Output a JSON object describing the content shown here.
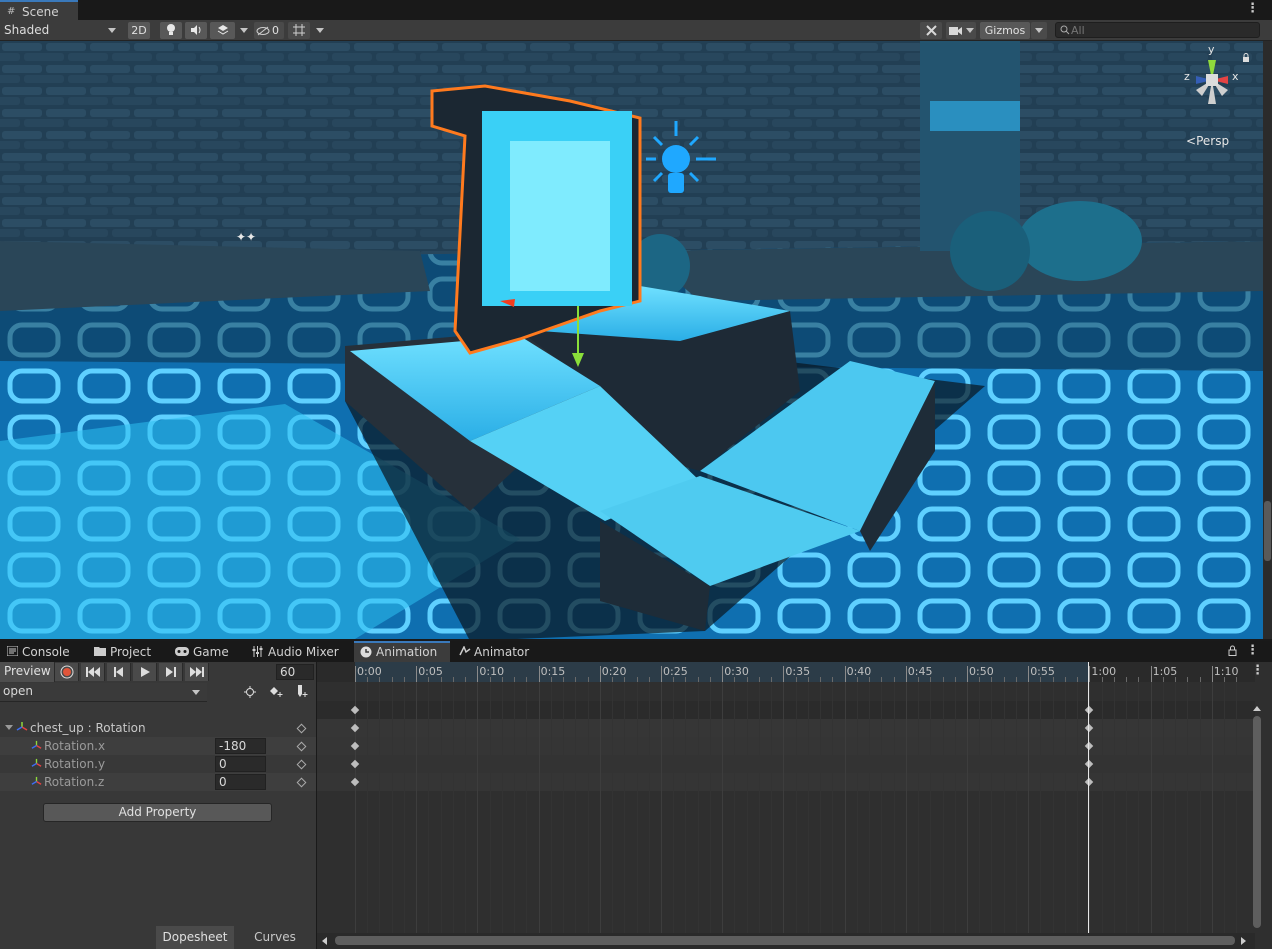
{
  "scene_tab": {
    "label": "Scene"
  },
  "scene_toolbar": {
    "shading_mode": "Shaded",
    "btn_2d": "2D",
    "hidden_count": "0",
    "gizmos_label": "Gizmos",
    "search_placeholder": "All"
  },
  "viewport": {
    "projection_label": "Persp",
    "axis_x": "x",
    "axis_y": "y",
    "axis_z": "z"
  },
  "bottom_tabs": [
    {
      "label": "Console",
      "icon": "console-icon"
    },
    {
      "label": "Project",
      "icon": "folder-icon"
    },
    {
      "label": "Game",
      "icon": "gamepad-icon"
    },
    {
      "label": "Audio Mixer",
      "icon": "mixer-icon"
    },
    {
      "label": "Animation",
      "icon": "clock-icon",
      "active": true
    },
    {
      "label": "Animator",
      "icon": "animator-icon"
    }
  ],
  "animation": {
    "preview_label": "Preview",
    "frame": "60",
    "clip": "open",
    "group_label": "chest_up : Rotation",
    "properties": [
      {
        "name": "Rotation.x",
        "value": "-180"
      },
      {
        "name": "Rotation.y",
        "value": "0"
      },
      {
        "name": "Rotation.z",
        "value": "0"
      }
    ],
    "add_property_label": "Add Property",
    "dopesheet_label": "Dopesheet",
    "curves_label": "Curves",
    "ticks": [
      "0:00",
      "0:05",
      "0:10",
      "0:15",
      "0:20",
      "0:25",
      "0:30",
      "0:35",
      "0:40",
      "0:45",
      "0:50",
      "0:55",
      "1:00",
      "1:05",
      "1:10"
    ]
  }
}
